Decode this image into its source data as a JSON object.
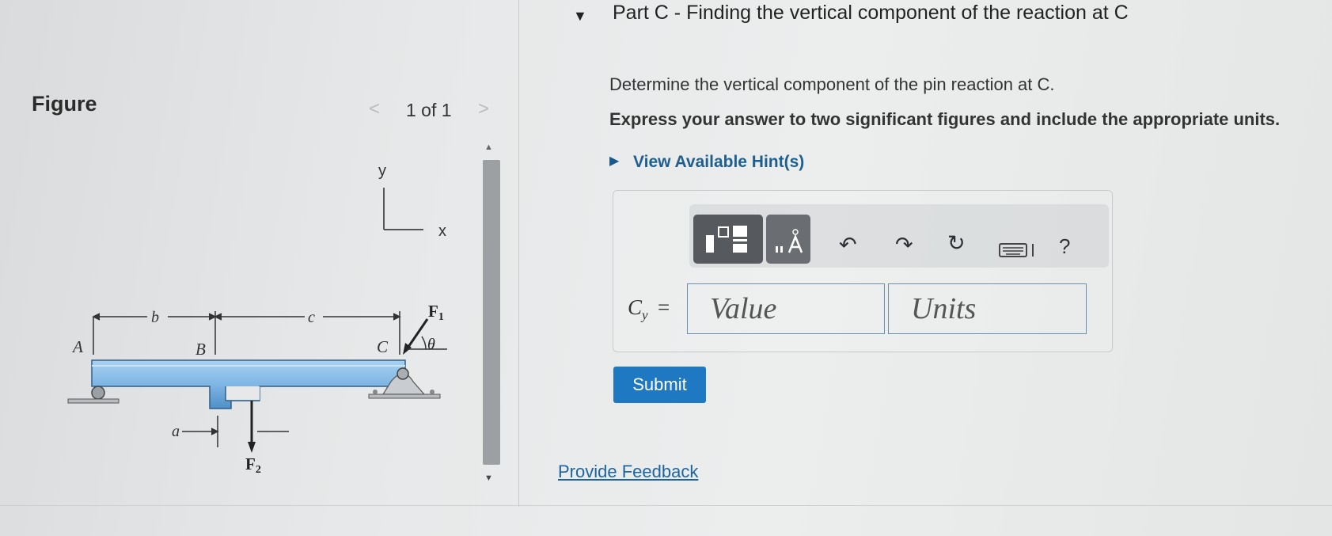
{
  "figure_panel": {
    "title": "Figure",
    "pager": {
      "prev": "<",
      "count": "1 of 1",
      "next": ">"
    },
    "diagram": {
      "axis_y": "y",
      "axis_x": "x",
      "label_A": "A",
      "label_B": "B",
      "label_C": "C",
      "dim_b": "b",
      "dim_c": "c",
      "dim_a": "a",
      "force_F1": "F",
      "force_F1_sub": "1",
      "force_F2": "F",
      "force_F2_sub": "2",
      "angle": "θ"
    }
  },
  "part": {
    "arrow": "▼",
    "title": "Part C - Finding the vertical component of the reaction at C",
    "prompt": "Determine the vertical component of the pin reaction at C.",
    "instructions": "Express your answer to two significant figures and include the appropriate units.",
    "hints_arrow": "▶",
    "hints_label": "View Available Hint(s)"
  },
  "answer": {
    "label": "C",
    "label_sub": "y",
    "equals": "=",
    "value_placeholder": "Value",
    "units_placeholder": "Units"
  },
  "toolbar": {
    "undo": "↶",
    "redo": "↷",
    "reset": "↻",
    "help": "?"
  },
  "actions": {
    "submit": "Submit",
    "feedback": "Provide Feedback"
  },
  "colors": {
    "beam": "#7fb6e4",
    "submit": "#1f78c2",
    "link": "#1e64a0"
  }
}
